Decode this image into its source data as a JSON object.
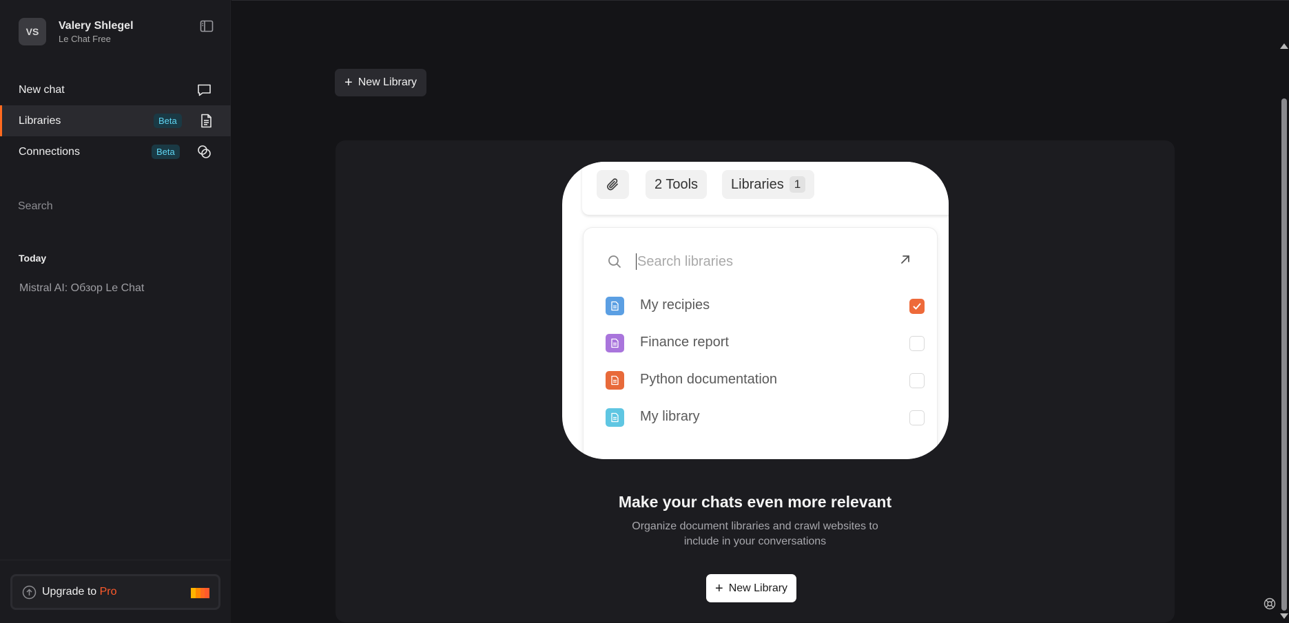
{
  "profile": {
    "initials": "VS",
    "name": "Valery Shlegel",
    "plan": "Le Chat Free"
  },
  "nav": {
    "new_chat": "New chat",
    "libraries": "Libraries",
    "libraries_badge": "Beta",
    "connections": "Connections",
    "connections_badge": "Beta"
  },
  "sidebar": {
    "search": "Search",
    "today_label": "Today",
    "history": [
      "Mistral AI: Обзор Le Chat"
    ],
    "upgrade_prefix": "Upgrade to ",
    "upgrade_pro": "Pro"
  },
  "main": {
    "new_library_top": "New Library",
    "headline": "Make your chats even more relevant",
    "subtext": "Organize document libraries and crawl websites to include in your conversations",
    "new_library_button": "New Library"
  },
  "illustration": {
    "tools_label": "2 Tools",
    "libraries_label": "Libraries",
    "libraries_count": "1",
    "search_placeholder": "Search libraries",
    "libraries": [
      {
        "name": "My recipies",
        "color": "#5b9fe3",
        "checked": true
      },
      {
        "name": "Finance report",
        "color": "#a975dc",
        "checked": false
      },
      {
        "name": "Python documentation",
        "color": "#e86a3a",
        "checked": false
      },
      {
        "name": "My library",
        "color": "#5fc6e2",
        "checked": false
      }
    ]
  },
  "colors": {
    "accent": "#ff6a1f",
    "pro": "#ff5a2b",
    "badge_text": "#5fd5f2",
    "check": "#ee6a3a"
  }
}
